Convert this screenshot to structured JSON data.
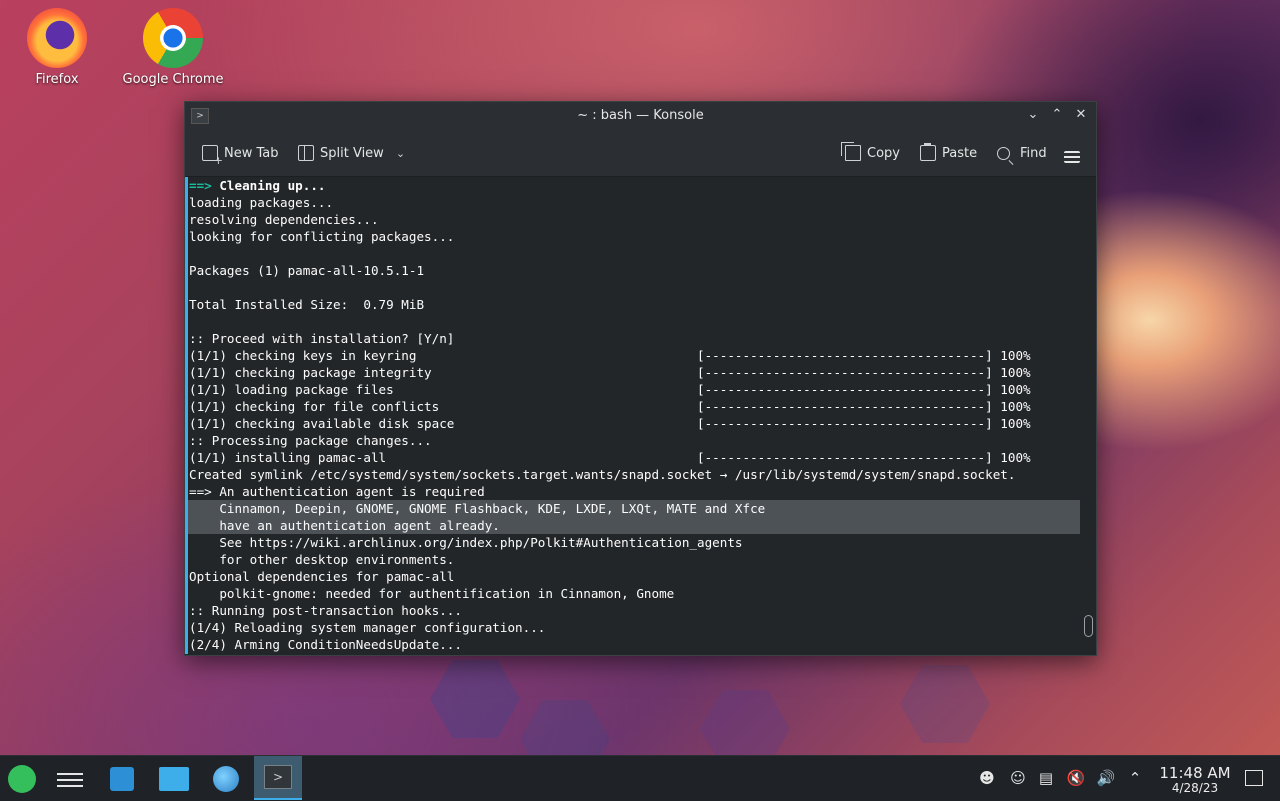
{
  "desktop": {
    "icons": [
      {
        "label": "Firefox"
      },
      {
        "label": "Google Chrome"
      }
    ]
  },
  "window": {
    "title": "~ : bash — Konsole",
    "toolbar": {
      "new_tab": "New Tab",
      "split_view": "Split View",
      "copy": "Copy",
      "paste": "Paste",
      "find": "Find"
    }
  },
  "terminal": {
    "lines": [
      {
        "prefix": "==>",
        "text": " Cleaning up...",
        "style": "bold"
      },
      {
        "text": "loading packages..."
      },
      {
        "text": "resolving dependencies..."
      },
      {
        "text": "looking for conflicting packages..."
      },
      {
        "text": ""
      },
      {
        "text": "Packages (1) pamac-all-10.5.1-1"
      },
      {
        "text": ""
      },
      {
        "text": "Total Installed Size:  0.79 MiB"
      },
      {
        "text": ""
      },
      {
        "text": ":: Proceed with installation? [Y/n]"
      },
      {
        "text": "(1/1) checking keys in keyring                                     [-------------------------------------] 100%"
      },
      {
        "text": "(1/1) checking package integrity                                   [-------------------------------------] 100%"
      },
      {
        "text": "(1/1) loading package files                                        [-------------------------------------] 100%"
      },
      {
        "text": "(1/1) checking for file conflicts                                  [-------------------------------------] 100%"
      },
      {
        "text": "(1/1) checking available disk space                                [-------------------------------------] 100%"
      },
      {
        "text": ":: Processing package changes..."
      },
      {
        "text": "(1/1) installing pamac-all                                         [-------------------------------------] 100%"
      },
      {
        "text": "Created symlink /etc/systemd/system/sockets.target.wants/snapd.socket → /usr/lib/systemd/system/snapd.socket."
      },
      {
        "text": "==> An authentication agent is required"
      },
      {
        "text": "    Cinnamon, Deepin, GNOME, GNOME Flashback, KDE, LXDE, LXQt, MATE and Xfce",
        "highlight": true
      },
      {
        "text": "    have an authentication agent already.",
        "highlight": true
      },
      {
        "text": "    See https://wiki.archlinux.org/index.php/Polkit#Authentication_agents"
      },
      {
        "text": "    for other desktop environments."
      },
      {
        "text": "Optional dependencies for pamac-all"
      },
      {
        "text": "    polkit-gnome: needed for authentification in Cinnamon, Gnome"
      },
      {
        "text": ":: Running post-transaction hooks..."
      },
      {
        "text": "(1/4) Reloading system manager configuration..."
      },
      {
        "text": "(2/4) Arming ConditionNeedsUpdate..."
      }
    ]
  },
  "taskbar": {
    "time": "11:48 AM",
    "date": "4/28/23"
  },
  "colors": {
    "accent": "#3daee9",
    "terminal_bg": "#232629",
    "prompt_cyan": "#1abc9c",
    "selection": "#4d5257"
  }
}
